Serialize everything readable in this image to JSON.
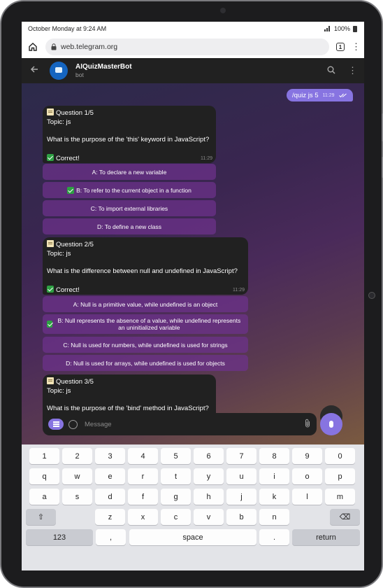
{
  "status_bar": {
    "datetime": "October Monday at 9:24 AM",
    "battery": "100%"
  },
  "browser": {
    "url": "web.telegram.org",
    "tab_count": "1"
  },
  "chat_header": {
    "title": "AIQuizMasterBot",
    "subtitle": "bot"
  },
  "outgoing": {
    "text": "/quiz js 5",
    "time": "11:29"
  },
  "questions": [
    {
      "header": "Question 1/5",
      "topic": "Topic: js",
      "question": "What is the purpose of the 'this' keyword in JavaScript?",
      "result": "Correct!",
      "time": "11:29",
      "options": [
        "A: To declare a new variable",
        "B: To refer to the current object in a function",
        "C: To import external libraries",
        "D: To define a new class"
      ]
    },
    {
      "header": "Question 2/5",
      "topic": "Topic: js",
      "question": "What is the difference between null and undefined in JavaScript?",
      "result": "Correct!",
      "time": "11:29",
      "options": [
        "A: Null is a primitive value, while undefined is an object",
        "B: Null represents the absence of a value, while undefined represents an uninitialized variable",
        "C: Null is used for numbers, while undefined is used for strings",
        "D: Null is used for arrays, while undefined is used for objects"
      ]
    },
    {
      "header": "Question 3/5",
      "topic": "Topic: js",
      "question": "What is the purpose of the 'bind' method in JavaScript?"
    }
  ],
  "composer": {
    "placeholder": "Message"
  },
  "keyboard": {
    "row1": [
      "1",
      "2",
      "3",
      "4",
      "5",
      "6",
      "7",
      "8",
      "9",
      "0"
    ],
    "row2": [
      "q",
      "w",
      "e",
      "r",
      "t",
      "y",
      "u",
      "i",
      "o",
      "p"
    ],
    "row3": [
      "a",
      "s",
      "d",
      "f",
      "g",
      "h",
      "j",
      "k",
      "l",
      "m"
    ],
    "row4": [
      "⇧",
      "z",
      "x",
      "c",
      "v",
      "b",
      "n",
      "⌫"
    ],
    "row5": [
      "123",
      ",",
      "space",
      ".",
      "return"
    ]
  }
}
